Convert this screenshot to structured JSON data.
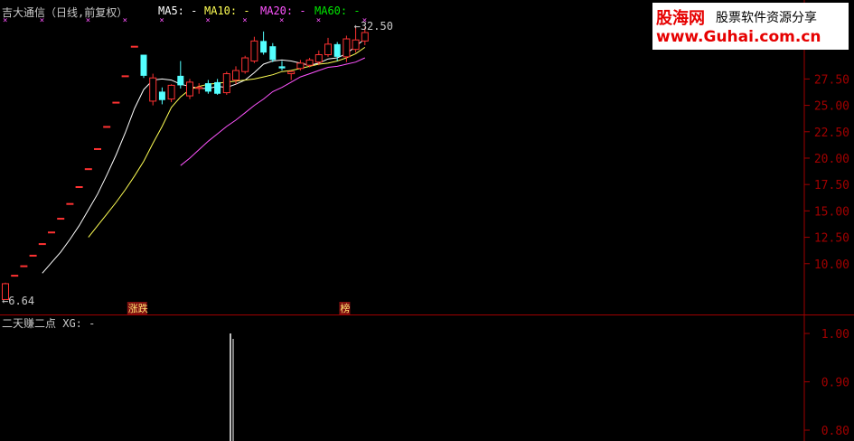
{
  "header": {
    "title": "吉大通信（日线,前复权）",
    "ma5": "MA5: -",
    "ma10": "MA10: -",
    "ma20": "MA20: -",
    "ma60": "MA60: -"
  },
  "indicator": {
    "label": "二天赚二点 XG: -"
  },
  "watermark": {
    "brand": "股海网",
    "tagline": "股票软件资源分享",
    "url": "www.Guhai.com.cn"
  },
  "colors": {
    "background": "#000000",
    "axis": "#a00000",
    "up": "#ff3232",
    "down": "#54ffff",
    "ma5": "#ffffff",
    "ma10": "#ffff54",
    "ma20": "#ff54ff",
    "ma60": "#00e600",
    "label_text": "#c8c8c8"
  },
  "chart_data": [
    {
      "type": "candlestick",
      "title": "吉大通信（日线,前复权）",
      "y_ticks": [
        "10.00",
        "12.50",
        "15.00",
        "17.50",
        "20.00",
        "22.50",
        "25.00",
        "27.50"
      ],
      "ylim": [
        6.0,
        33.5
      ],
      "grid": false,
      "max_label": "32.50",
      "min_label": "6.64",
      "markers": [
        "涨跌",
        "榜"
      ],
      "candles": [
        {
          "o": 6.6,
          "h": 8.2,
          "l": 6.6,
          "c": 8.1
        },
        {
          "o": 8.9,
          "h": 8.9,
          "l": 8.9,
          "c": 8.9
        },
        {
          "o": 9.8,
          "h": 9.8,
          "l": 9.8,
          "c": 9.8
        },
        {
          "o": 10.8,
          "h": 10.8,
          "l": 10.8,
          "c": 10.8
        },
        {
          "o": 11.9,
          "h": 11.9,
          "l": 11.9,
          "c": 11.9
        },
        {
          "o": 13.0,
          "h": 13.0,
          "l": 13.0,
          "c": 13.0
        },
        {
          "o": 14.3,
          "h": 14.3,
          "l": 14.3,
          "c": 14.3
        },
        {
          "o": 15.7,
          "h": 15.7,
          "l": 15.7,
          "c": 15.7
        },
        {
          "o": 17.3,
          "h": 17.3,
          "l": 17.3,
          "c": 17.3
        },
        {
          "o": 19.0,
          "h": 19.0,
          "l": 19.0,
          "c": 19.0
        },
        {
          "o": 20.9,
          "h": 20.9,
          "l": 20.9,
          "c": 20.9
        },
        {
          "o": 23.0,
          "h": 23.0,
          "l": 23.0,
          "c": 23.0
        },
        {
          "o": 25.3,
          "h": 25.3,
          "l": 25.3,
          "c": 25.3
        },
        {
          "o": 27.8,
          "h": 27.8,
          "l": 27.8,
          "c": 27.8
        },
        {
          "o": 30.6,
          "h": 30.6,
          "l": 30.6,
          "c": 30.6
        },
        {
          "o": 29.8,
          "h": 29.8,
          "l": 27.6,
          "c": 27.8
        },
        {
          "o": 25.4,
          "h": 28.0,
          "l": 25.0,
          "c": 27.6
        },
        {
          "o": 26.3,
          "h": 26.7,
          "l": 25.1,
          "c": 25.5
        },
        {
          "o": 25.6,
          "h": 27.0,
          "l": 25.3,
          "c": 26.9
        },
        {
          "o": 27.8,
          "h": 29.2,
          "l": 26.6,
          "c": 26.9
        },
        {
          "o": 25.9,
          "h": 27.5,
          "l": 25.6,
          "c": 27.2
        },
        {
          "o": 26.6,
          "h": 27.1,
          "l": 26.1,
          "c": 26.7
        },
        {
          "o": 27.1,
          "h": 27.4,
          "l": 26.1,
          "c": 26.3
        },
        {
          "o": 27.2,
          "h": 27.5,
          "l": 26.0,
          "c": 26.1
        },
        {
          "o": 26.2,
          "h": 28.2,
          "l": 26.0,
          "c": 28.0
        },
        {
          "o": 27.4,
          "h": 28.7,
          "l": 27.0,
          "c": 28.3
        },
        {
          "o": 28.2,
          "h": 29.7,
          "l": 28.0,
          "c": 29.5
        },
        {
          "o": 29.2,
          "h": 31.5,
          "l": 29.0,
          "c": 31.1
        },
        {
          "o": 31.1,
          "h": 32.0,
          "l": 29.8,
          "c": 30.0
        },
        {
          "o": 30.6,
          "h": 30.9,
          "l": 29.1,
          "c": 29.3
        },
        {
          "o": 28.7,
          "h": 29.2,
          "l": 28.3,
          "c": 28.5
        },
        {
          "o": 28.0,
          "h": 28.3,
          "l": 27.4,
          "c": 28.2
        },
        {
          "o": 28.5,
          "h": 29.3,
          "l": 28.3,
          "c": 29.0
        },
        {
          "o": 28.8,
          "h": 29.5,
          "l": 28.6,
          "c": 29.3
        },
        {
          "o": 29.1,
          "h": 30.2,
          "l": 28.8,
          "c": 29.8
        },
        {
          "o": 29.8,
          "h": 31.4,
          "l": 29.6,
          "c": 30.8
        },
        {
          "o": 30.8,
          "h": 31.0,
          "l": 29.2,
          "c": 29.6
        },
        {
          "o": 29.6,
          "h": 31.6,
          "l": 29.1,
          "c": 31.3
        },
        {
          "o": 30.3,
          "h": 32.5,
          "l": 30.0,
          "c": 31.2
        },
        {
          "o": 31.1,
          "h": 32.4,
          "l": 30.7,
          "c": 31.9
        }
      ],
      "series": [
        {
          "name": "MA5",
          "values": [
            null,
            null,
            null,
            null,
            9.1,
            10.1,
            11.1,
            12.3,
            13.6,
            15.1,
            16.6,
            18.4,
            20.3,
            22.4,
            24.7,
            26.5,
            27.4,
            27.5,
            27.4,
            27.0,
            26.8,
            26.6,
            26.6,
            26.8,
            26.7,
            27.0,
            27.4,
            28.1,
            28.9,
            29.2,
            29.3,
            29.2,
            29.0,
            28.8,
            29.0,
            29.4,
            29.5,
            29.9,
            30.6,
            31.3
          ]
        },
        {
          "name": "MA10",
          "values": [
            null,
            null,
            null,
            null,
            null,
            null,
            null,
            null,
            null,
            12.5,
            13.6,
            14.7,
            15.8,
            17.0,
            18.3,
            19.7,
            21.4,
            23.0,
            24.8,
            25.8,
            26.5,
            26.8,
            27.0,
            27.1,
            27.2,
            27.3,
            27.4,
            27.5,
            27.7,
            27.9,
            28.2,
            28.3,
            28.5,
            28.7,
            28.9,
            29.0,
            29.2,
            29.5,
            29.9,
            30.5
          ]
        },
        {
          "name": "MA20",
          "values": [
            null,
            null,
            null,
            null,
            null,
            null,
            null,
            null,
            null,
            null,
            null,
            null,
            null,
            null,
            null,
            null,
            null,
            null,
            null,
            19.3,
            20.0,
            20.8,
            21.6,
            22.3,
            23.0,
            23.6,
            24.3,
            25.0,
            25.6,
            26.3,
            26.7,
            27.2,
            27.7,
            28.0,
            28.3,
            28.6,
            28.7,
            28.9,
            29.1,
            29.5
          ]
        },
        {
          "name": "MA60",
          "values": []
        }
      ]
    },
    {
      "type": "bar",
      "title": "二天赚二点 XG: -",
      "y_ticks": [
        "1.00",
        "0.90",
        "0.80"
      ],
      "ylim": [
        0.77,
        1.03
      ],
      "grid": false,
      "signal_index": 20,
      "signal_value": 1.0
    }
  ]
}
